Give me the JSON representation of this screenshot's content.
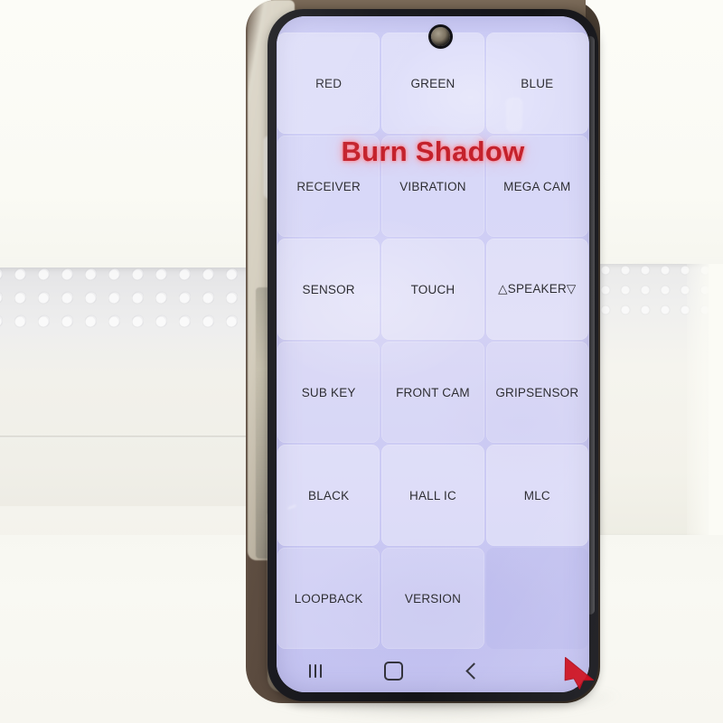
{
  "scene": {
    "subject": "smartphone-display-test-screen",
    "background_description": "white styrofoam foam blocks on a white table"
  },
  "phone": {
    "camera_icon": "punch-hole-camera",
    "screen_bg_color": "#ccccf6",
    "bezel_color": "#1b1b20"
  },
  "screen": {
    "overlay_text": "Burn Shadow",
    "overlay_color": "#c4222c",
    "grid": {
      "columns": 3,
      "rows": 6,
      "buttons": [
        {
          "label": "RED"
        },
        {
          "label": "GREEN"
        },
        {
          "label": "BLUE"
        },
        {
          "label": "RECEIVER"
        },
        {
          "label": "VIBRATION"
        },
        {
          "label": "MEGA CAM"
        },
        {
          "label": "SENSOR"
        },
        {
          "label": "TOUCH"
        },
        {
          "label": "△SPEAKER▽"
        },
        {
          "label": "SUB KEY"
        },
        {
          "label": "FRONT CAM"
        },
        {
          "label": "GRIPSENSOR"
        },
        {
          "label": "BLACK"
        },
        {
          "label": "HALL IC"
        },
        {
          "label": "MLC"
        },
        {
          "label": "LOOPBACK"
        },
        {
          "label": "VERSION"
        },
        {
          "label": ""
        }
      ]
    }
  },
  "navbar": {
    "items": [
      {
        "icon": "recents-icon",
        "label": "Recents"
      },
      {
        "icon": "home-icon",
        "label": "Home"
      },
      {
        "icon": "back-icon",
        "label": "Back"
      }
    ]
  },
  "annotation": {
    "cursor_icon": "red-arrow-cursor",
    "color": "#cc1122"
  }
}
